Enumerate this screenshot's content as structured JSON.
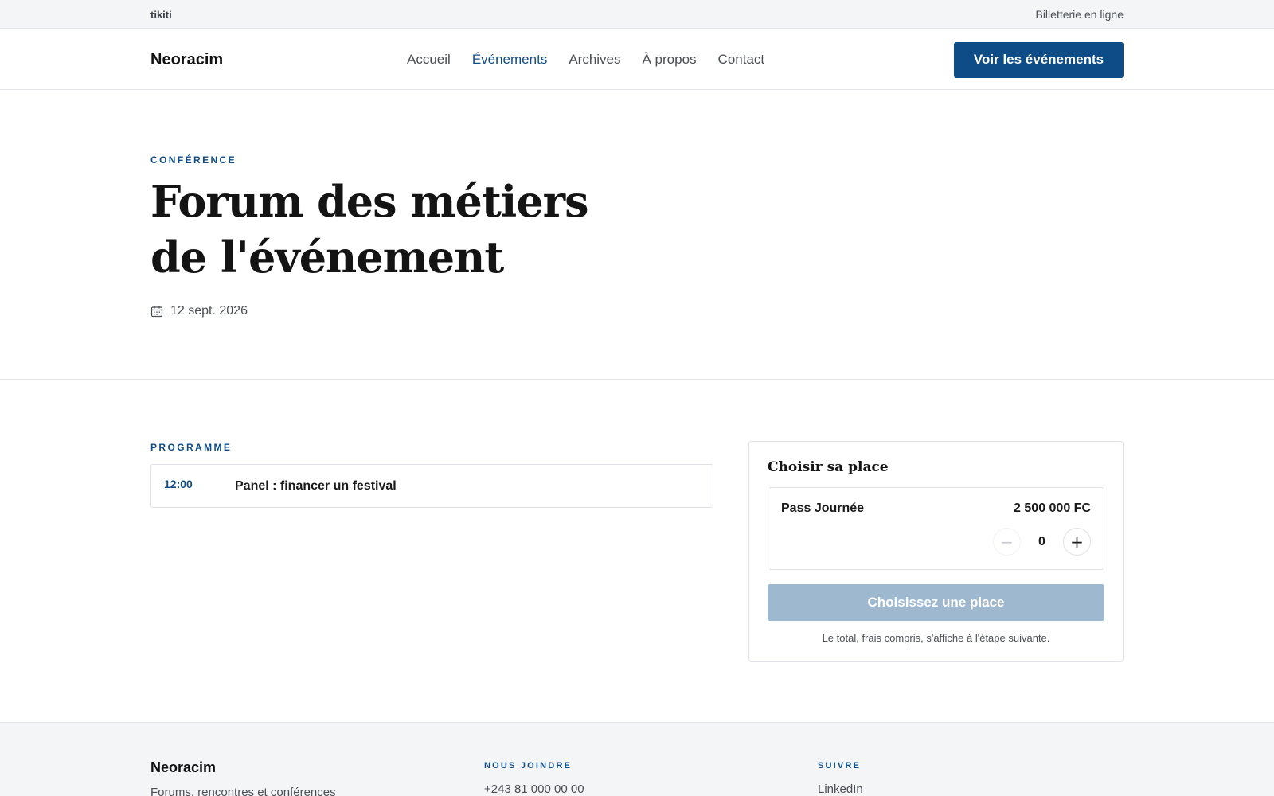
{
  "topbar": {
    "brand": "tikiti",
    "tagline": "Billetterie en ligne"
  },
  "header": {
    "logo": "Neoracim",
    "nav": [
      {
        "label": "Accueil",
        "active": false
      },
      {
        "label": "Événements",
        "active": true
      },
      {
        "label": "Archives",
        "active": false
      },
      {
        "label": "À propos",
        "active": false
      },
      {
        "label": "Contact",
        "active": false
      }
    ],
    "cta": "Voir les événements"
  },
  "hero": {
    "eyebrow": "CONFÉRENCE",
    "title_line1": "Forum des métiers",
    "title_line2": "de l'événement",
    "date": "12 sept. 2026",
    "date_icon": "calendar-icon"
  },
  "program": {
    "heading": "PROGRAMME",
    "items": [
      {
        "time": "12:00",
        "title": "Panel : financer un festival"
      }
    ]
  },
  "ticket": {
    "title": "Choisir sa place",
    "item": {
      "name": "Pass Journée",
      "price": "2 500 000 FC",
      "quantity": "0"
    },
    "minus": "−",
    "plus": "+",
    "button": "Choisissez une place",
    "note": "Le total, frais compris, s'affiche à l'étape suivante."
  },
  "footer": {
    "brand": "Neoracim",
    "desc": "Forums, rencontres et conférences",
    "contact_heading": "NOUS JOINDRE",
    "phone": "+243 81 000 00 00",
    "follow_heading": "SUIVRE",
    "social": "LinkedIn"
  },
  "colors": {
    "accent": "#0d4c86",
    "button_disabled": "#9db8cf",
    "border": "#dfe2e6",
    "muted_bg": "#f4f5f7"
  }
}
